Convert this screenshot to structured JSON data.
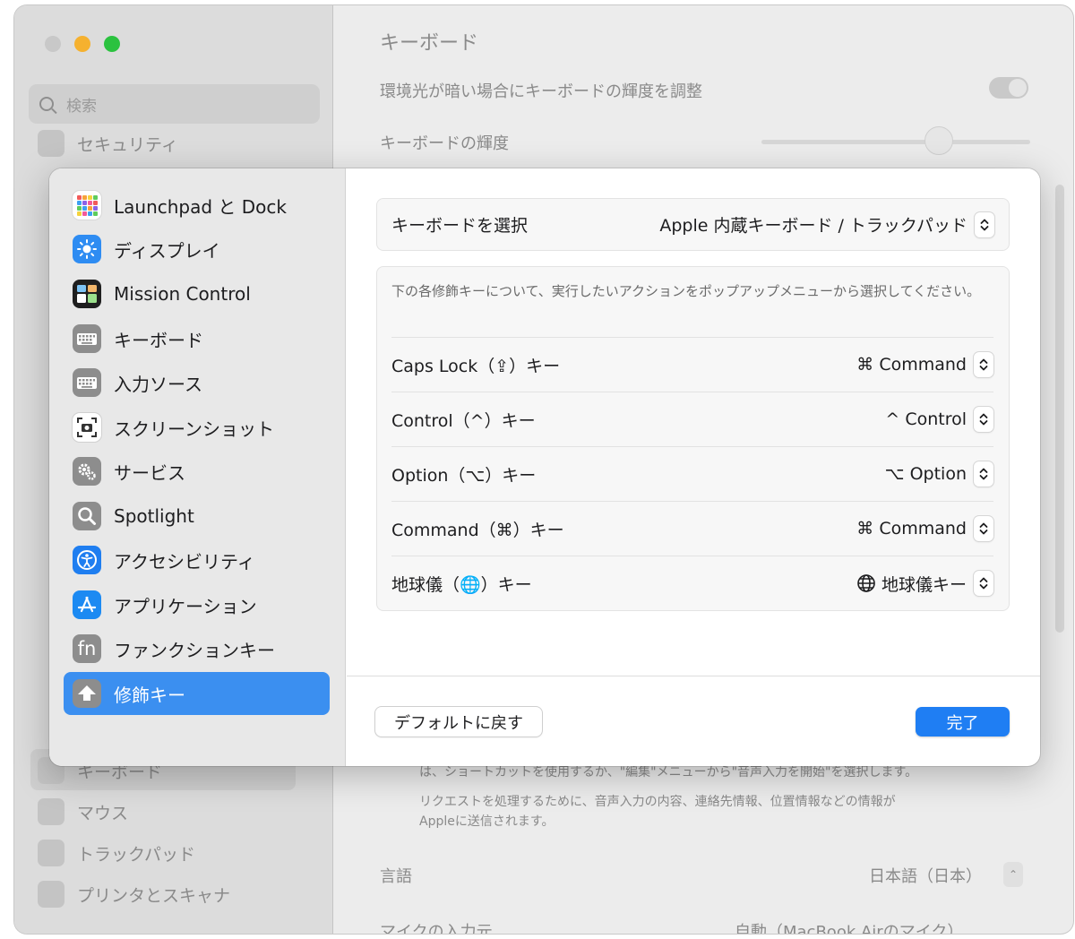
{
  "background": {
    "window_title": "キーボード",
    "search_placeholder": "検索",
    "sidebar_items": [
      {
        "label": "セキュリティ"
      },
      {
        "label": "キーボード"
      },
      {
        "label": "マウス"
      },
      {
        "label": "トラックパッド"
      },
      {
        "label": "プリンタとスキャナ"
      }
    ],
    "rows": {
      "ambient_light": "環境光が暗い場合にキーボードの輝度を調整",
      "brightness": "キーボードの輝度",
      "dictation_note_1": "は、ショートカットを使用するか、\"編集\"メニューから\"音声入力を開始\"を選択します。",
      "dictation_note_2": "リクエストを処理するために、音声入力の内容、連絡先情報、位置情報などの情報が",
      "dictation_note_3": "Appleに送信されます。",
      "language_label": "言語",
      "language_value": "日本語（日本）",
      "mic_label": "マイクの入力元",
      "mic_value": "自動（MacBook Airのマイク）"
    }
  },
  "sheet": {
    "nav_items": [
      {
        "label": "Launchpad と Dock",
        "icon": "launchpad-dock-icon"
      },
      {
        "label": "ディスプレイ",
        "icon": "display-icon"
      },
      {
        "label": "Mission Control",
        "icon": "mission-control-icon"
      },
      {
        "label": "キーボード",
        "icon": "keyboard-icon"
      },
      {
        "label": "入力ソース",
        "icon": "input-sources-icon"
      },
      {
        "label": "スクリーンショット",
        "icon": "screenshot-icon"
      },
      {
        "label": "サービス",
        "icon": "services-icon"
      },
      {
        "label": "Spotlight",
        "icon": "spotlight-icon"
      },
      {
        "label": "アクセシビリティ",
        "icon": "accessibility-icon"
      },
      {
        "label": "アプリケーション",
        "icon": "app-store-icon"
      },
      {
        "label": "ファンクションキー",
        "icon": "fn-icon"
      },
      {
        "label": "修飾キー",
        "icon": "modifier-keys-icon",
        "selected": true
      }
    ],
    "fn_icon_text": "fn",
    "keyboard_select": {
      "label": "キーボードを選択",
      "value": "Apple 内蔵キーボード / トラックパッド"
    },
    "description": "下の各修飾キーについて、実行したいアクションをポップアップメニューから選択してください。",
    "modifier_rows": [
      {
        "label": "Caps Lock（⇪）キー",
        "value": "⌘ Command"
      },
      {
        "label": "Control（^）キー",
        "value": "^ Control"
      },
      {
        "label": "Option（⌥）キー",
        "value": "⌥ Option"
      },
      {
        "label": "Command（⌘）キー",
        "value": "⌘ Command"
      },
      {
        "label": "地球儀（🌐）キー",
        "value": "地球儀キー"
      }
    ],
    "reset_button": "デフォルトに戻す",
    "done_button": "完了"
  },
  "colors": {
    "accent": "#1f7ef3",
    "selected_row": "#3b8ff0",
    "traffic_close": "#c8c8c8",
    "traffic_minimize": "#f5b12f",
    "traffic_zoom": "#2bc23f"
  }
}
